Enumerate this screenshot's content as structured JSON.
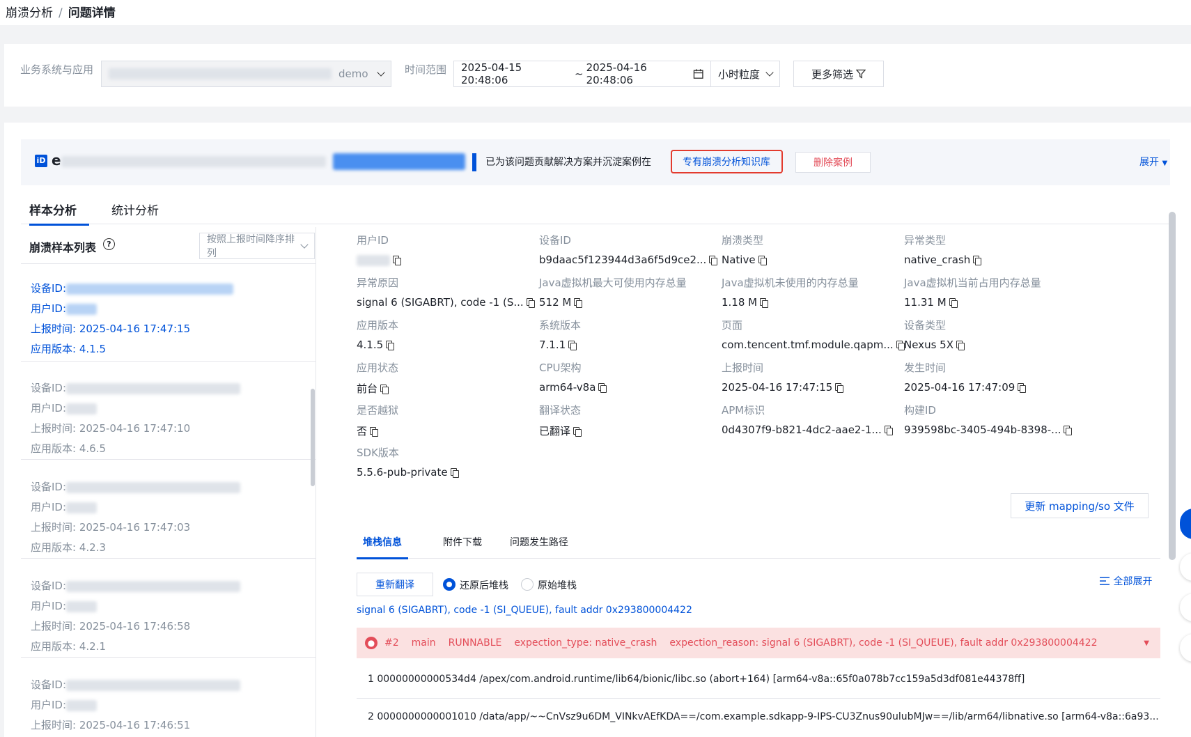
{
  "breadcrumb": {
    "parent": "崩溃分析",
    "separator": "/",
    "current": "问题详情"
  },
  "filters": {
    "system_label": "业务系统与应用",
    "system_value": "demo",
    "time_label": "时间范围",
    "time_start": "2025-04-15 20:48:06",
    "time_sep": "~",
    "time_end": "2025-04-16 20:48:06",
    "granularity": "小时粒度",
    "more_filters": "更多筛选"
  },
  "banner": {
    "issue_id_prefix": "e",
    "contribute_text": "已为该问题贡献解决方案并沉淀案例在",
    "kb_link": "专有崩溃分析知识库",
    "delete_case": "删除案例",
    "expand": "展开"
  },
  "tabs": [
    {
      "label": "样本分析"
    },
    {
      "label": "统计分析"
    }
  ],
  "sample_list": {
    "title": "崩溃样本列表",
    "sort_placeholder": "按照上报时间降序排列",
    "labels": {
      "device": "设备ID:",
      "user": "用户ID:",
      "time": "上报时间:",
      "version": "应用版本:"
    },
    "items": [
      {
        "time": "2025-04-16 17:47:15",
        "version": "4.1.5"
      },
      {
        "time": "2025-04-16 17:47:10",
        "version": "4.6.5"
      },
      {
        "time": "2025-04-16 17:47:03",
        "version": "4.2.3"
      },
      {
        "time": "2025-04-16 17:46:58",
        "version": "4.2.1"
      },
      {
        "time": "2025-04-16 17:46:51",
        "version": ""
      }
    ]
  },
  "details": [
    {
      "label": "用户ID",
      "value": ""
    },
    {
      "label": "设备ID",
      "value": "b9daac5f123944d3a6f5d9ce2..."
    },
    {
      "label": "崩溃类型",
      "value": "Native"
    },
    {
      "label": "异常类型",
      "value": "native_crash"
    },
    {
      "label": "异常原因",
      "value": "signal 6 (SIGABRT), code -1 (S..."
    },
    {
      "label": "Java虚拟机最大可使用内存总量",
      "value": "512 M"
    },
    {
      "label": "Java虚拟机未使用的内存总量",
      "value": "1.18 M"
    },
    {
      "label": "Java虚拟机当前占用内存总量",
      "value": "11.31 M"
    },
    {
      "label": "应用版本",
      "value": "4.1.5"
    },
    {
      "label": "系统版本",
      "value": "7.1.1"
    },
    {
      "label": "页面",
      "value": "com.tencent.tmf.module.qapm..."
    },
    {
      "label": "设备类型",
      "value": "Nexus 5X"
    },
    {
      "label": "应用状态",
      "value": "前台"
    },
    {
      "label": "CPU架构",
      "value": "arm64-v8a"
    },
    {
      "label": "上报时间",
      "value": "2025-04-16 17:47:15"
    },
    {
      "label": "发生时间",
      "value": "2025-04-16 17:47:09"
    },
    {
      "label": "是否越狱",
      "value": "否"
    },
    {
      "label": "翻译状态",
      "value": "已翻译"
    },
    {
      "label": "APM标识",
      "value": "0d4307f9-b821-4dc2-aae2-1..."
    },
    {
      "label": "构建ID",
      "value": "939598bc-3405-494b-8398-..."
    },
    {
      "label": "SDK版本",
      "value": "5.5.6-pub-private"
    }
  ],
  "update_mapping": "更新 mapping/so 文件",
  "stack_tabs": [
    {
      "label": "堆栈信息"
    },
    {
      "label": "附件下载"
    },
    {
      "label": "问题发生路径"
    }
  ],
  "stack": {
    "retranslate": "重新翻译",
    "radio_restored": "还原后堆栈",
    "radio_raw": "原始堆栈",
    "expand_all": "全部展开",
    "signal_line": "signal 6 (SIGABRT), code -1 (SI_QUEUE), fault addr 0x293800004422",
    "thread": {
      "num": "#2",
      "name": "main",
      "state": "RUNNABLE",
      "type": "expection_type: native_crash",
      "reason": "expection_reason: signal 6 (SIGABRT), code -1 (SI_QUEUE), fault addr 0x293800004422"
    },
    "frames": [
      "1 00000000000534d4 /apex/com.android.runtime/lib64/bionic/libc.so (abort+164) [arm64-v8a::65f0a078b7cc159a5d3df081e44378ff]",
      "2 0000000000001010 /data/app/~~CnVsz9u6DM_VINkvAEfKDA==/com.example.sdkapp-9-IPS-CU3Znus90ulubMJw==/lib/arm64/libnative.so [arm64-v8a::6a93..."
    ]
  },
  "colors": {
    "primary": "#0052d9",
    "danger": "#e34d59",
    "error_bg": "#fbe1e1"
  }
}
